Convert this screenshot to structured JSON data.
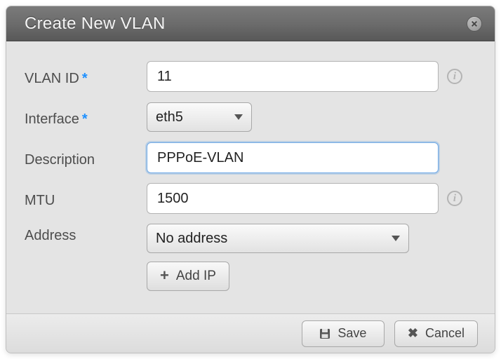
{
  "dialog": {
    "title": "Create New VLAN"
  },
  "fields": {
    "vlan_id": {
      "label": "VLAN ID",
      "value": "11",
      "required": true,
      "info": true
    },
    "interface": {
      "label": "Interface",
      "value": "eth5",
      "required": true,
      "info": false
    },
    "description": {
      "label": "Description",
      "value": "PPPoE-VLAN",
      "required": false,
      "info": false
    },
    "mtu": {
      "label": "MTU",
      "value": "1500",
      "required": false,
      "info": true
    },
    "address": {
      "label": "Address",
      "value": "No address",
      "required": false,
      "info": false
    }
  },
  "buttons": {
    "add_ip": "Add IP",
    "save": "Save",
    "cancel": "Cancel"
  },
  "required_marker": "*",
  "info_glyph": "i"
}
